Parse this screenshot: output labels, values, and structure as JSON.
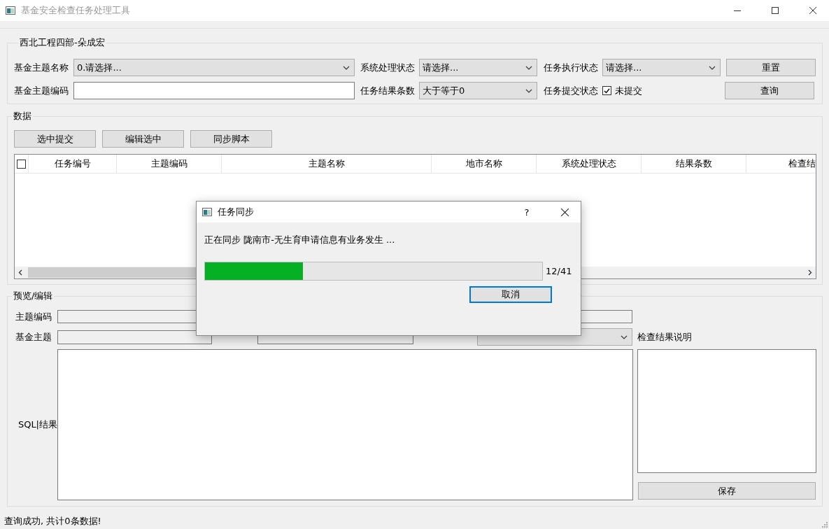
{
  "window": {
    "title": "基金安全检查任务处理工具"
  },
  "filter": {
    "title": "西北工程四部-朵成宏",
    "theme_name": {
      "label": "基金主题名称",
      "value": "0.请选择..."
    },
    "system_status": {
      "label": "系统处理状态",
      "value": "请选择..."
    },
    "exec_status": {
      "label": "任务执行状态",
      "value": "请选择..."
    },
    "theme_code": {
      "label": "基金主题编码"
    },
    "result_count": {
      "label": "任务结果条数",
      "value": "大于等于0"
    },
    "submit_status": {
      "label": "任务提交状态",
      "option": "未提交",
      "checked": true
    },
    "buttons": [
      "重置",
      "查询"
    ]
  },
  "data": {
    "title": "数据",
    "buttons": [
      "选中提交",
      "编辑选中",
      "同步脚本"
    ],
    "table": {
      "select_all_checked": false,
      "columns": [
        "任务编号",
        "主题编码",
        "主题名称",
        "地市名称",
        "系统处理状态",
        "结果条数",
        "检查结"
      ]
    }
  },
  "editor": {
    "title": "预览/编辑",
    "theme_code_label": "主题编码",
    "theme_label": "基金主题",
    "sql_label": "SQL|结果",
    "note_label": "检查结果说明",
    "save_button": "保存"
  },
  "status_bar": "查询成功, 共计0条数据!",
  "dialog": {
    "title": "任务同步",
    "help": "?",
    "message": "正在同步 陇南市-无生育申请信息有业务发生 ...",
    "progress": {
      "level": 0.29,
      "reading": "12/41"
    },
    "button": "取消"
  }
}
